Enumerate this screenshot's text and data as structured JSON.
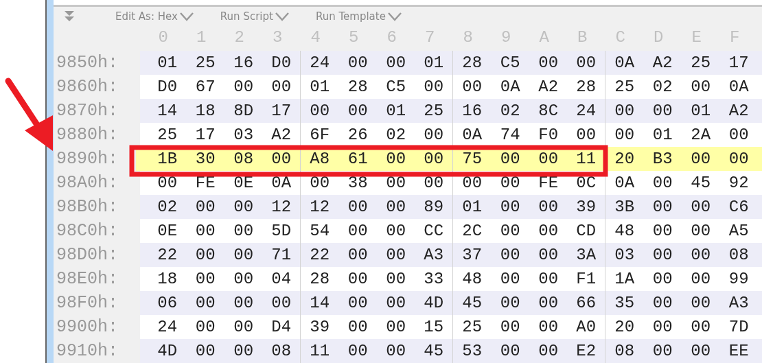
{
  "toolbar": [
    {
      "label": "Edit As: Hex"
    },
    {
      "label": "Run Script"
    },
    {
      "label": "Run Template"
    }
  ],
  "column_headers": [
    "0",
    "1",
    "2",
    "3",
    "4",
    "5",
    "6",
    "7",
    "8",
    "9",
    "A",
    "B",
    "C",
    "D",
    "E",
    "F"
  ],
  "rows": [
    {
      "address": "9850h:",
      "selected": false,
      "bytes": [
        "01",
        "25",
        "16",
        "D0",
        "24",
        "00",
        "00",
        "01",
        "28",
        "C5",
        "00",
        "00",
        "0A",
        "A2",
        "25",
        "17"
      ]
    },
    {
      "address": "9860h:",
      "selected": false,
      "bytes": [
        "D0",
        "67",
        "00",
        "00",
        "01",
        "28",
        "C5",
        "00",
        "00",
        "0A",
        "A2",
        "28",
        "25",
        "02",
        "00",
        "0A"
      ]
    },
    {
      "address": "9870h:",
      "selected": false,
      "bytes": [
        "14",
        "18",
        "8D",
        "17",
        "00",
        "00",
        "01",
        "25",
        "16",
        "02",
        "8C",
        "24",
        "00",
        "00",
        "01",
        "A2"
      ]
    },
    {
      "address": "9880h:",
      "selected": false,
      "bytes": [
        "25",
        "17",
        "03",
        "A2",
        "6F",
        "26",
        "02",
        "00",
        "0A",
        "74",
        "F0",
        "00",
        "00",
        "01",
        "2A",
        "00"
      ]
    },
    {
      "address": "9890h:",
      "selected": true,
      "bytes": [
        "1B",
        "30",
        "08",
        "00",
        "A8",
        "61",
        "00",
        "00",
        "75",
        "00",
        "00",
        "11",
        "20",
        "B3",
        "00",
        "00"
      ]
    },
    {
      "address": "98A0h:",
      "selected": false,
      "bytes": [
        "00",
        "FE",
        "0E",
        "0A",
        "00",
        "38",
        "00",
        "00",
        "00",
        "00",
        "FE",
        "0C",
        "0A",
        "00",
        "45",
        "92"
      ]
    },
    {
      "address": "98B0h:",
      "selected": false,
      "bytes": [
        "02",
        "00",
        "00",
        "12",
        "12",
        "00",
        "00",
        "89",
        "01",
        "00",
        "00",
        "39",
        "3B",
        "00",
        "00",
        "C6"
      ]
    },
    {
      "address": "98C0h:",
      "selected": false,
      "bytes": [
        "0E",
        "00",
        "00",
        "5D",
        "54",
        "00",
        "00",
        "CC",
        "2C",
        "00",
        "00",
        "CD",
        "48",
        "00",
        "00",
        "A5"
      ]
    },
    {
      "address": "98D0h:",
      "selected": false,
      "bytes": [
        "22",
        "00",
        "00",
        "71",
        "22",
        "00",
        "00",
        "A3",
        "37",
        "00",
        "00",
        "3A",
        "03",
        "00",
        "00",
        "08"
      ]
    },
    {
      "address": "98E0h:",
      "selected": false,
      "bytes": [
        "18",
        "00",
        "00",
        "04",
        "28",
        "00",
        "00",
        "33",
        "48",
        "00",
        "00",
        "F1",
        "1A",
        "00",
        "00",
        "99"
      ]
    },
    {
      "address": "98F0h:",
      "selected": false,
      "bytes": [
        "06",
        "00",
        "00",
        "00",
        "14",
        "00",
        "00",
        "4D",
        "45",
        "00",
        "00",
        "66",
        "35",
        "00",
        "00",
        "A3"
      ]
    },
    {
      "address": "9900h:",
      "selected": false,
      "bytes": [
        "24",
        "00",
        "00",
        "D4",
        "39",
        "00",
        "00",
        "15",
        "25",
        "00",
        "00",
        "A0",
        "20",
        "00",
        "00",
        "7D"
      ]
    },
    {
      "address": "9910h:",
      "selected": false,
      "bytes": [
        "4D",
        "00",
        "00",
        "08",
        "11",
        "00",
        "00",
        "45",
        "53",
        "00",
        "00",
        "E2",
        "08",
        "00",
        "00",
        "EE"
      ]
    }
  ]
}
